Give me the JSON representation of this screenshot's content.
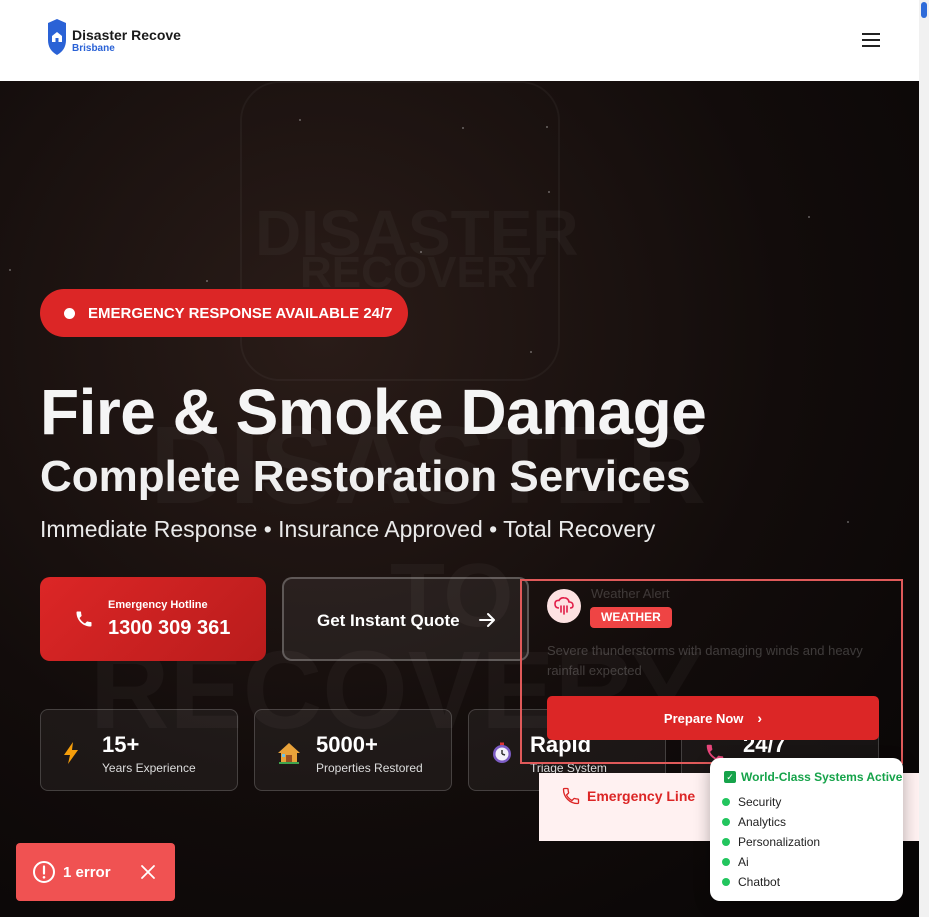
{
  "header": {
    "logo_title": "Disaster Recove",
    "logo_subtitle": "Brisbane",
    "menu_icon": "hamburger-menu-icon"
  },
  "hero": {
    "badge": "EMERGENCY RESPONSE AVAILABLE 24/7",
    "title": "Fire & Smoke Damage",
    "subtitle": "Complete Restoration Services",
    "tagline": "Immediate Response • Insurance Approved • Total Recovery",
    "hotline": {
      "label": "Emergency Hotline",
      "number": "1300 309 361",
      "icon": "phone-icon"
    },
    "quote_button": {
      "label": "Get Instant Quote",
      "icon": "arrow-right-icon"
    },
    "stats": [
      {
        "value": "15+",
        "label": "Years Experience",
        "icon": "lightning-icon"
      },
      {
        "value": "5000+",
        "label": "Properties Restored",
        "icon": "house-icon"
      },
      {
        "value": "Rapid",
        "label": "Triage System",
        "icon": "stopwatch-icon"
      },
      {
        "value": "24/7",
        "label": "",
        "icon": "phone-icon"
      }
    ]
  },
  "weather_alert": {
    "title": "Weather Alert",
    "tag": "WEATHER",
    "text": "Severe thunderstorms with damaging winds and heavy rainfall expected",
    "button": "Prepare Now",
    "icon": "cloud-rain-icon"
  },
  "emergency_line": {
    "label": "Emergency Line",
    "icon": "phone-icon"
  },
  "systems_panel": {
    "title": "World-Class Systems Active",
    "items": [
      "Security",
      "Analytics",
      "Personalization",
      "Ai",
      "Chatbot"
    ]
  },
  "error_toast": {
    "label": "1 error",
    "icon": "alert-circle-icon",
    "close_icon": "close-icon"
  },
  "colors": {
    "accent_red": "#dc2626",
    "success_green": "#16a34a",
    "brand_blue": "#2a62d6"
  }
}
